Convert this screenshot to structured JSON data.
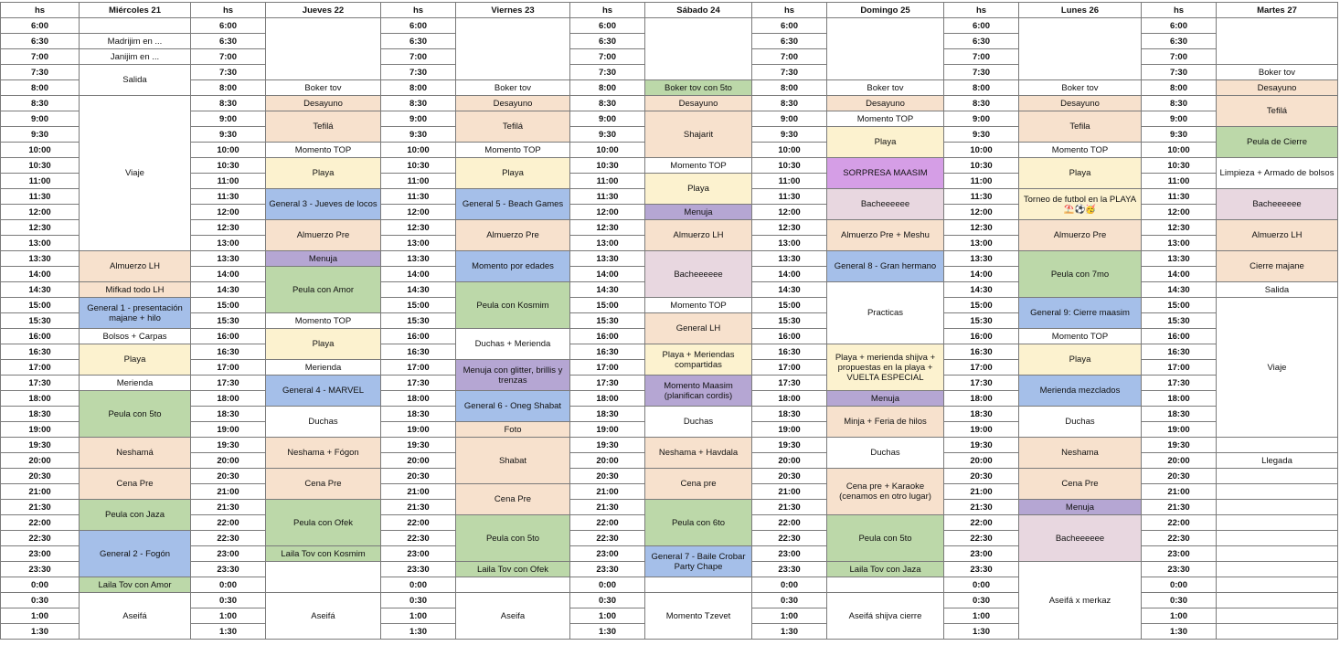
{
  "colors": {
    "white": "#ffffff",
    "peach": "#f7e1cd",
    "yellow": "#fcf2cf",
    "blue": "#a5bfe9",
    "green": "#bcd8a9",
    "purple": "#b5a6d3",
    "mauve": "#e8d7e0",
    "magenta": "#d59ee6"
  },
  "headers": [
    "hs",
    "Miércoles 21",
    "hs",
    "Jueves 22",
    "hs",
    "Viernes 23",
    "hs",
    "Sábado 24",
    "hs",
    "Domingo 25",
    "hs",
    "Lunes 26",
    "hs",
    "Martes 27"
  ],
  "times": [
    "6:00",
    "6:30",
    "7:00",
    "7:30",
    "8:00",
    "8:30",
    "9:00",
    "9:30",
    "10:00",
    "10:30",
    "11:00",
    "11:30",
    "12:00",
    "12:30",
    "13:00",
    "13:30",
    "14:00",
    "14:30",
    "15:00",
    "15:30",
    "16:00",
    "16:30",
    "17:00",
    "17:30",
    "18:00",
    "18:30",
    "19:00",
    "19:30",
    "20:00",
    "20:30",
    "21:00",
    "21:30",
    "22:00",
    "22:30",
    "23:00",
    "23:30",
    "0:00",
    "0:30",
    "1:00",
    "1:30"
  ],
  "days": [
    {
      "name": "Miércoles 21",
      "events": [
        {
          "start": 0,
          "span": 1,
          "label": "",
          "color": "white"
        },
        {
          "start": 1,
          "span": 1,
          "label": "Madrijim en ...",
          "color": "white"
        },
        {
          "start": 2,
          "span": 1,
          "label": "Janijim en ...",
          "color": "white"
        },
        {
          "start": 3,
          "span": 2,
          "label": "Salida",
          "color": "white"
        },
        {
          "start": 5,
          "span": 10,
          "label": "Viaje",
          "color": "white"
        },
        {
          "start": 15,
          "span": 2,
          "label": "Almuerzo LH",
          "color": "peach"
        },
        {
          "start": 17,
          "span": 1,
          "label": "Mifkad todo LH",
          "color": "peach"
        },
        {
          "start": 18,
          "span": 2,
          "label": "General 1 - presentación majane + hilo",
          "color": "blue"
        },
        {
          "start": 20,
          "span": 1,
          "label": "Bolsos + Carpas",
          "color": "white"
        },
        {
          "start": 21,
          "span": 2,
          "label": "Playa",
          "color": "yellow"
        },
        {
          "start": 23,
          "span": 1,
          "label": "Merienda",
          "color": "white"
        },
        {
          "start": 24,
          "span": 3,
          "label": "Peula con 5to",
          "color": "green"
        },
        {
          "start": 27,
          "span": 2,
          "label": "Neshamá",
          "color": "peach"
        },
        {
          "start": 29,
          "span": 2,
          "label": "Cena Pre",
          "color": "peach"
        },
        {
          "start": 31,
          "span": 2,
          "label": "Peula con Jaza",
          "color": "green"
        },
        {
          "start": 33,
          "span": 3,
          "label": "General 2 - Fogón",
          "color": "blue"
        },
        {
          "start": 36,
          "span": 1,
          "label": "Laila Tov con Amor",
          "color": "green"
        },
        {
          "start": 37,
          "span": 3,
          "label": "Aseifá",
          "color": "white"
        }
      ]
    },
    {
      "name": "Jueves 22",
      "events": [
        {
          "start": 0,
          "span": 4,
          "label": "",
          "color": "white"
        },
        {
          "start": 4,
          "span": 1,
          "label": "Boker tov",
          "color": "white"
        },
        {
          "start": 5,
          "span": 1,
          "label": "Desayuno",
          "color": "peach"
        },
        {
          "start": 6,
          "span": 2,
          "label": "Tefilá",
          "color": "peach"
        },
        {
          "start": 8,
          "span": 1,
          "label": "Momento TOP",
          "color": "white"
        },
        {
          "start": 9,
          "span": 2,
          "label": "Playa",
          "color": "yellow"
        },
        {
          "start": 11,
          "span": 2,
          "label": "General 3 - Jueves de locos",
          "color": "blue"
        },
        {
          "start": 13,
          "span": 2,
          "label": "Almuerzo Pre",
          "color": "peach"
        },
        {
          "start": 15,
          "span": 1,
          "label": "Menuja",
          "color": "purple"
        },
        {
          "start": 16,
          "span": 3,
          "label": "Peula con Amor",
          "color": "green"
        },
        {
          "start": 19,
          "span": 1,
          "label": "Momento TOP",
          "color": "white"
        },
        {
          "start": 20,
          "span": 2,
          "label": "Playa",
          "color": "yellow"
        },
        {
          "start": 22,
          "span": 1,
          "label": "Merienda",
          "color": "white"
        },
        {
          "start": 23,
          "span": 2,
          "label": "General 4 - MARVEL",
          "color": "blue"
        },
        {
          "start": 25,
          "span": 2,
          "label": "Duchas",
          "color": "white"
        },
        {
          "start": 27,
          "span": 2,
          "label": "Neshama + Fógon",
          "color": "peach"
        },
        {
          "start": 29,
          "span": 2,
          "label": "Cena Pre",
          "color": "peach"
        },
        {
          "start": 31,
          "span": 3,
          "label": "Peula con Ofek",
          "color": "green"
        },
        {
          "start": 34,
          "span": 1,
          "label": "Laila Tov con Kosmim",
          "color": "green"
        },
        {
          "start": 35,
          "span": 2,
          "label": "",
          "color": "white"
        },
        {
          "start": 37,
          "span": 3,
          "label": "Aseifá",
          "color": "white"
        }
      ]
    },
    {
      "name": "Viernes 23",
      "events": [
        {
          "start": 0,
          "span": 4,
          "label": "",
          "color": "white"
        },
        {
          "start": 4,
          "span": 1,
          "label": "Boker tov",
          "color": "white"
        },
        {
          "start": 5,
          "span": 1,
          "label": "Desayuno",
          "color": "peach"
        },
        {
          "start": 6,
          "span": 2,
          "label": "Tefilá",
          "color": "peach"
        },
        {
          "start": 8,
          "span": 1,
          "label": "Momento TOP",
          "color": "white"
        },
        {
          "start": 9,
          "span": 2,
          "label": "Playa",
          "color": "yellow"
        },
        {
          "start": 11,
          "span": 2,
          "label": "General 5 - Beach Games",
          "color": "blue"
        },
        {
          "start": 13,
          "span": 2,
          "label": "Almuerzo Pre",
          "color": "peach"
        },
        {
          "start": 15,
          "span": 2,
          "label": "Momento por edades",
          "color": "blue"
        },
        {
          "start": 17,
          "span": 3,
          "label": "Peula con Kosmim",
          "color": "green"
        },
        {
          "start": 20,
          "span": 2,
          "label": "Duchas + Merienda",
          "color": "white"
        },
        {
          "start": 22,
          "span": 2,
          "label": "Menuja con glitter, brillis y trenzas",
          "color": "purple"
        },
        {
          "start": 24,
          "span": 2,
          "label": "General 6 - Oneg Shabat",
          "color": "blue"
        },
        {
          "start": 26,
          "span": 1,
          "label": "Foto",
          "color": "peach"
        },
        {
          "start": 27,
          "span": 3,
          "label": "Shabat",
          "color": "peach"
        },
        {
          "start": 30,
          "span": 2,
          "label": "Cena Pre",
          "color": "peach"
        },
        {
          "start": 32,
          "span": 3,
          "label": "Peula con 5to",
          "color": "green"
        },
        {
          "start": 35,
          "span": 1,
          "label": "Laila Tov con Ofek",
          "color": "green"
        },
        {
          "start": 36,
          "span": 1,
          "label": "",
          "color": "white"
        },
        {
          "start": 37,
          "span": 3,
          "label": "Aseifa",
          "color": "white"
        }
      ]
    },
    {
      "name": "Sábado 24",
      "events": [
        {
          "start": 0,
          "span": 4,
          "label": "",
          "color": "white"
        },
        {
          "start": 4,
          "span": 1,
          "label": "Boker tov con 5to",
          "color": "green"
        },
        {
          "start": 5,
          "span": 1,
          "label": "Desayuno",
          "color": "peach"
        },
        {
          "start": 6,
          "span": 3,
          "label": "Shajarit",
          "color": "peach"
        },
        {
          "start": 9,
          "span": 1,
          "label": "Momento TOP",
          "color": "white"
        },
        {
          "start": 10,
          "span": 2,
          "label": "Playa",
          "color": "yellow"
        },
        {
          "start": 12,
          "span": 1,
          "label": "Menuja",
          "color": "purple"
        },
        {
          "start": 13,
          "span": 2,
          "label": "Almuerzo LH",
          "color": "peach"
        },
        {
          "start": 15,
          "span": 3,
          "label": "Bacheeeeee",
          "color": "mauve"
        },
        {
          "start": 18,
          "span": 1,
          "label": "Momento TOP",
          "color": "white"
        },
        {
          "start": 19,
          "span": 2,
          "label": "General LH",
          "color": "peach"
        },
        {
          "start": 21,
          "span": 2,
          "label": "Playa + Meriendas compartidas",
          "color": "yellow"
        },
        {
          "start": 23,
          "span": 2,
          "label": "Momento Maasim (planifican cordis)",
          "color": "purple"
        },
        {
          "start": 25,
          "span": 2,
          "label": "Duchas",
          "color": "white"
        },
        {
          "start": 27,
          "span": 2,
          "label": "Neshama + Havdala",
          "color": "peach"
        },
        {
          "start": 29,
          "span": 2,
          "label": "Cena pre",
          "color": "peach"
        },
        {
          "start": 31,
          "span": 3,
          "label": "Peula con 6to",
          "color": "green"
        },
        {
          "start": 34,
          "span": 2,
          "label": "General 7 - Baile Crobar Party Chape",
          "color": "blue"
        },
        {
          "start": 36,
          "span": 1,
          "label": "",
          "color": "white"
        },
        {
          "start": 37,
          "span": 3,
          "label": "Momento Tzevet",
          "color": "white"
        }
      ]
    },
    {
      "name": "Domingo 25",
      "events": [
        {
          "start": 0,
          "span": 4,
          "label": "",
          "color": "white"
        },
        {
          "start": 4,
          "span": 1,
          "label": "Boker tov",
          "color": "white"
        },
        {
          "start": 5,
          "span": 1,
          "label": "Desayuno",
          "color": "peach"
        },
        {
          "start": 6,
          "span": 1,
          "label": "Momento TOP",
          "color": "white"
        },
        {
          "start": 7,
          "span": 2,
          "label": "Playa",
          "color": "yellow"
        },
        {
          "start": 9,
          "span": 2,
          "label": "SORPRESA MAASIM",
          "color": "magenta"
        },
        {
          "start": 11,
          "span": 2,
          "label": "Bacheeeeee",
          "color": "mauve"
        },
        {
          "start": 13,
          "span": 2,
          "label": "Almuerzo Pre + Meshu",
          "color": "peach"
        },
        {
          "start": 15,
          "span": 2,
          "label": "General 8 - Gran hermano",
          "color": "blue"
        },
        {
          "start": 17,
          "span": 4,
          "label": "Practicas",
          "color": "white"
        },
        {
          "start": 21,
          "span": 3,
          "label": "Playa + merienda shijva + propuestas en la playa + VUELTA ESPECIAL",
          "color": "yellow"
        },
        {
          "start": 24,
          "span": 1,
          "label": "Menuja",
          "color": "purple"
        },
        {
          "start": 25,
          "span": 2,
          "label": "Minja + Feria de hilos",
          "color": "peach"
        },
        {
          "start": 27,
          "span": 2,
          "label": "Duchas",
          "color": "white"
        },
        {
          "start": 29,
          "span": 3,
          "label": "Cena pre + Karaoke (cenamos en otro lugar)",
          "color": "peach"
        },
        {
          "start": 32,
          "span": 3,
          "label": "Peula con 5to",
          "color": "green"
        },
        {
          "start": 35,
          "span": 1,
          "label": "Laila Tov con Jaza",
          "color": "green"
        },
        {
          "start": 36,
          "span": 1,
          "label": "",
          "color": "white"
        },
        {
          "start": 37,
          "span": 3,
          "label": "Aseifá shijva cierre",
          "color": "white"
        }
      ]
    },
    {
      "name": "Lunes 26",
      "events": [
        {
          "start": 0,
          "span": 4,
          "label": "",
          "color": "white"
        },
        {
          "start": 4,
          "span": 1,
          "label": "Boker tov",
          "color": "white"
        },
        {
          "start": 5,
          "span": 1,
          "label": "Desayuno",
          "color": "peach"
        },
        {
          "start": 6,
          "span": 2,
          "label": "Tefila",
          "color": "peach"
        },
        {
          "start": 8,
          "span": 1,
          "label": "Momento TOP",
          "color": "white"
        },
        {
          "start": 9,
          "span": 2,
          "label": "Playa",
          "color": "yellow"
        },
        {
          "start": 11,
          "span": 2,
          "label": "Torneo de futbol en la PLAYA⛱️⚽🥳",
          "color": "yellow"
        },
        {
          "start": 13,
          "span": 2,
          "label": "Almuerzo Pre",
          "color": "peach"
        },
        {
          "start": 15,
          "span": 3,
          "label": "Peula con 7mo",
          "color": "green"
        },
        {
          "start": 18,
          "span": 2,
          "label": "General 9: Cierre maasim",
          "color": "blue"
        },
        {
          "start": 20,
          "span": 1,
          "label": "Momento TOP",
          "color": "white"
        },
        {
          "start": 21,
          "span": 2,
          "label": "Playa",
          "color": "yellow"
        },
        {
          "start": 23,
          "span": 2,
          "label": "Merienda mezclados",
          "color": "blue"
        },
        {
          "start": 25,
          "span": 2,
          "label": "Duchas",
          "color": "white"
        },
        {
          "start": 27,
          "span": 2,
          "label": "Neshama",
          "color": "peach"
        },
        {
          "start": 29,
          "span": 2,
          "label": "Cena Pre",
          "color": "peach"
        },
        {
          "start": 31,
          "span": 1,
          "label": "Menuja",
          "color": "purple"
        },
        {
          "start": 32,
          "span": 3,
          "label": "Bacheeeeee",
          "color": "mauve"
        },
        {
          "start": 35,
          "span": 5,
          "label": "Aseifá x merkaz",
          "color": "white"
        }
      ]
    },
    {
      "name": "Martes 27",
      "events": [
        {
          "start": 0,
          "span": 3,
          "label": "",
          "color": "white"
        },
        {
          "start": 3,
          "span": 1,
          "label": "Boker tov",
          "color": "white"
        },
        {
          "start": 4,
          "span": 1,
          "label": "Desayuno",
          "color": "peach"
        },
        {
          "start": 5,
          "span": 2,
          "label": "Tefilá",
          "color": "peach"
        },
        {
          "start": 7,
          "span": 2,
          "label": "Peula de Cierre",
          "color": "green"
        },
        {
          "start": 9,
          "span": 2,
          "label": "Limpieza + Armado de bolsos",
          "color": "white"
        },
        {
          "start": 11,
          "span": 2,
          "label": "Bacheeeeee",
          "color": "mauve"
        },
        {
          "start": 13,
          "span": 2,
          "label": "Almuerzo LH",
          "color": "peach"
        },
        {
          "start": 15,
          "span": 2,
          "label": "Cierre majane",
          "color": "peach"
        },
        {
          "start": 17,
          "span": 1,
          "label": "Salida",
          "color": "white"
        },
        {
          "start": 18,
          "span": 9,
          "label": "Viaje",
          "color": "white"
        },
        {
          "start": 27,
          "span": 1,
          "label": "",
          "color": "white"
        },
        {
          "start": 28,
          "span": 1,
          "label": "Llegada",
          "color": "white"
        },
        {
          "start": 29,
          "span": 1,
          "label": "",
          "color": "white"
        },
        {
          "start": 30,
          "span": 1,
          "label": "",
          "color": "white"
        },
        {
          "start": 31,
          "span": 1,
          "label": "",
          "color": "white"
        },
        {
          "start": 32,
          "span": 1,
          "label": "",
          "color": "white"
        },
        {
          "start": 33,
          "span": 1,
          "label": "",
          "color": "white"
        },
        {
          "start": 34,
          "span": 1,
          "label": "",
          "color": "white"
        },
        {
          "start": 35,
          "span": 1,
          "label": "",
          "color": "white"
        },
        {
          "start": 36,
          "span": 1,
          "label": "",
          "color": "white"
        },
        {
          "start": 37,
          "span": 1,
          "label": "",
          "color": "white"
        },
        {
          "start": 38,
          "span": 1,
          "label": "",
          "color": "white"
        },
        {
          "start": 39,
          "span": 1,
          "label": "",
          "color": "white"
        }
      ]
    }
  ]
}
